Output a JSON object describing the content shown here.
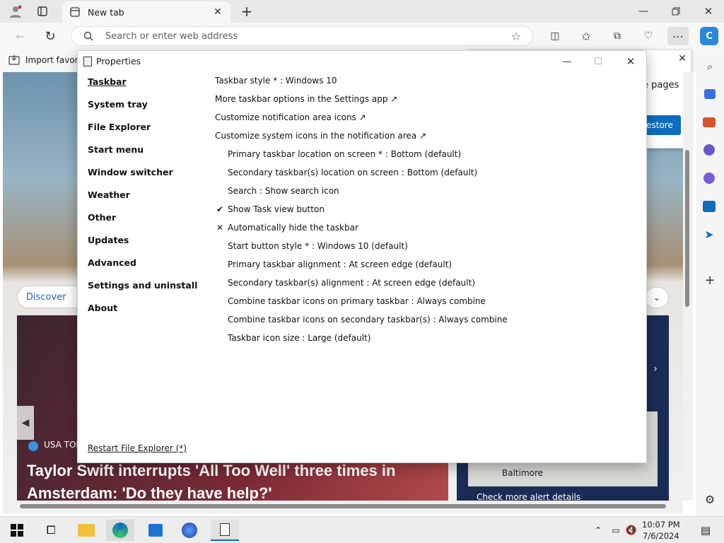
{
  "browser": {
    "tab_title": "New tab",
    "address_placeholder": "Search or enter web address",
    "favorites_item": "Import favorites",
    "discover_label": "Discover",
    "popup_text": "e pages",
    "popup_button": "estore"
  },
  "news": {
    "source": "USA TOD",
    "headline": "Taylor Swift interrupts 'All Too Well' three times in Amsterdam: 'Do they have help?'",
    "map_city": "Baltimore",
    "alert_link": "Check more alert details"
  },
  "window": {
    "title": "Properties",
    "nav": [
      "Taskbar",
      "System tray",
      "File Explorer",
      "Start menu",
      "Window switcher",
      "Weather",
      "Other",
      "Updates",
      "Advanced",
      "Settings and uninstall",
      "About"
    ],
    "options": [
      {
        "label": "Taskbar style * : Windows 10",
        "indent": false,
        "mark": ""
      },
      {
        "label": "More taskbar options in the Settings app ↗",
        "indent": false,
        "mark": ""
      },
      {
        "label": "Customize notification area icons ↗",
        "indent": false,
        "mark": ""
      },
      {
        "label": "Customize system icons in the notification area ↗",
        "indent": false,
        "mark": ""
      },
      {
        "label": "Primary taskbar location on screen * : Bottom (default)",
        "indent": true,
        "mark": ""
      },
      {
        "label": "Secondary taskbar(s) location on screen : Bottom (default)",
        "indent": true,
        "mark": ""
      },
      {
        "label": "Search : Show search icon",
        "indent": true,
        "mark": ""
      },
      {
        "label": "Show Task view button",
        "indent": true,
        "mark": "✔"
      },
      {
        "label": "Automatically hide the taskbar",
        "indent": true,
        "mark": "✕"
      },
      {
        "label": "Start button style * : Windows 10 (default)",
        "indent": true,
        "mark": ""
      },
      {
        "label": "Primary taskbar alignment : At screen edge (default)",
        "indent": true,
        "mark": ""
      },
      {
        "label": "Secondary taskbar(s) alignment : At screen edge (default)",
        "indent": true,
        "mark": ""
      },
      {
        "label": "Combine taskbar icons on primary taskbar : Always combine",
        "indent": true,
        "mark": ""
      },
      {
        "label": "Combine taskbar icons on secondary taskbar(s) : Always combine",
        "indent": true,
        "mark": ""
      },
      {
        "label": "Taskbar icon size : Large (default)",
        "indent": true,
        "mark": ""
      }
    ],
    "restart_link": "Restart File Explorer (*)"
  },
  "taskbar": {
    "time": "10:07 PM",
    "date": "7/6/2024"
  },
  "colors": {
    "accent": "#0f6cbd",
    "edge_blue": "#1b64c8"
  }
}
